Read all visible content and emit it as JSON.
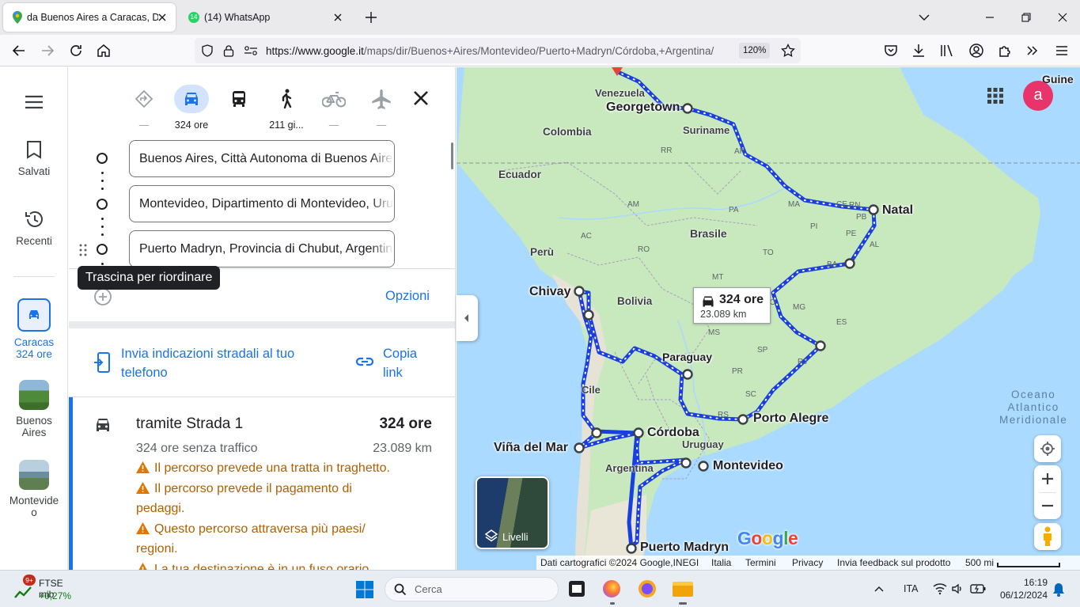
{
  "browser": {
    "tabs": [
      {
        "title": "da Buenos Aires a Caracas, Distanza",
        "active": true
      },
      {
        "title": "(14) WhatsApp",
        "badge": "14",
        "active": false
      }
    ],
    "url_prefix": "https://www.google.it",
    "url_rest": "/maps/dir/Buenos+Aires/Montevideo/Puerto+Madryn/Córdoba,+Argentina/",
    "zoom": "120%"
  },
  "rail": {
    "saved_label": "Salvati",
    "recent_label": "Recenti",
    "active_route": {
      "line1": "Caracas",
      "line2": "324 ore"
    },
    "recent_places": [
      {
        "label": "Buenos Aires"
      },
      {
        "label": "Montevide o"
      }
    ]
  },
  "modes": {
    "car_time": "324 ore",
    "walk_time": "211 gi...",
    "best_dash": "—",
    "transit_dash": "",
    "bike_dash": "—",
    "flight_dash": "—"
  },
  "waypoints": [
    "Buenos Aires, Città Autonoma di Buenos Aires, Argentina",
    "Montevideo, Dipartimento di Montevideo, Uruguay",
    "Puerto Madryn, Provincia di Chubut, Argentina"
  ],
  "tooltip": "Trascina per riordinare",
  "options_label": "Opzioni",
  "send_to_phone": {
    "line1": "Invia indicazioni stradali al tuo",
    "line2": "telefono"
  },
  "copy_link": {
    "line1": "Copia",
    "line2": "link"
  },
  "route": {
    "via": "tramite Strada 1",
    "time": "324 ore",
    "traffic_note": "324 ore senza traffico",
    "distance": "23.089 km",
    "warnings": [
      {
        "lines": [
          "Il percorso prevede una tratta in traghetto."
        ]
      },
      {
        "lines": [
          "Il percorso prevede il pagamento di",
          "pedaggi."
        ]
      },
      {
        "lines": [
          "Questo percorso attraversa più paesi/",
          "regioni."
        ]
      },
      {
        "lines": [
          "La tua destinazione è in un fuso orario"
        ]
      }
    ]
  },
  "map": {
    "cities": [
      "Georgetown",
      "Natal",
      "Chivay",
      "Paraguay",
      "Porto Alegre",
      "Córdoba",
      "Viña del Mar",
      "Montevideo",
      "Puerto Madryn",
      "Guine"
    ],
    "countries": [
      "Venezuela",
      "Suriname",
      "Colombia",
      "Ecuador",
      "Brasile",
      "Perù",
      "Bolivia",
      "Cile",
      "Uruguay",
      "Argentina"
    ],
    "states": [
      "RR",
      "AP",
      "AM",
      "PA",
      "MA",
      "CE",
      "RN",
      "PB",
      "PE",
      "AL",
      "PI",
      "TO",
      "BA",
      "AC",
      "RO",
      "MT",
      "GO",
      "MG",
      "ES",
      "MS",
      "SP",
      "RJ",
      "PR",
      "SC",
      "RS"
    ],
    "ocean": [
      "Oceano",
      "Atlantico",
      "Meridionale"
    ],
    "route_box": {
      "time": "324 ore",
      "distance": "23.089 km"
    },
    "avatar_letter": "a",
    "layers_label": "Livelli",
    "logo": "Google",
    "footer": {
      "data_credit": "Dati cartografici ©2024 Google,INEGI",
      "country": "Italia",
      "terms": "Termini",
      "privacy": "Privacy",
      "feedback": "Invia feedback sul prodotto",
      "scale": "500 mi"
    },
    "colors": {
      "route": "#1a3fe0",
      "land": "#c8e8bd",
      "water": "#aadaff",
      "andes": "#e6e2d6"
    }
  },
  "taskbar": {
    "widget_title": "FTSE mib",
    "widget_value": "+0,27%",
    "widget_badge": "9+",
    "search_placeholder": "Cerca",
    "lang": "ITA",
    "time": "16:19",
    "date": "06/12/2024"
  }
}
